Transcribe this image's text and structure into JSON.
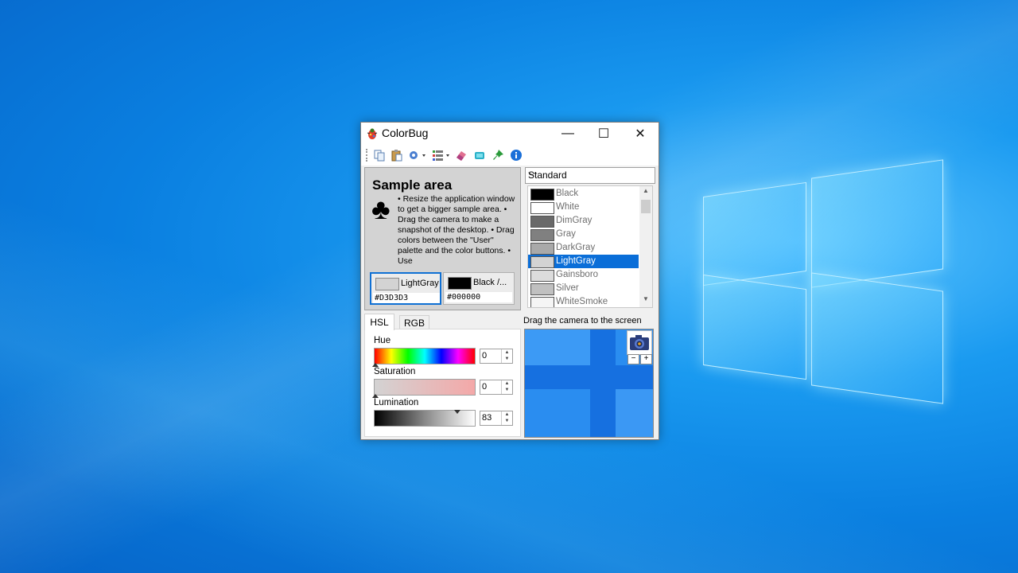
{
  "window": {
    "title": "ColorBug",
    "controls": {
      "minimize": "—",
      "maximize": "☐",
      "close": "✕"
    }
  },
  "toolbar": {
    "items": [
      "copy-icon",
      "paste-icon",
      "settings-icon",
      "palette-list-icon",
      "eraser-icon",
      "tape-icon",
      "pin-icon",
      "info-icon"
    ]
  },
  "sample": {
    "title": "Sample area",
    "text": "• Resize the application window to get a bigger sample area. • Drag the camera to make a snapshot of the desktop. • Drag colors between the \"User\" palette and the color buttons. • Use",
    "button1": {
      "label": "LightGray",
      "hex": "#D3D3D3",
      "color": "#d3d3d3"
    },
    "button2": {
      "label": "Black /...",
      "hex": "#000000",
      "color": "#000000"
    }
  },
  "palette": {
    "selected": "Standard",
    "items": [
      {
        "name": "Black",
        "color": "#000000"
      },
      {
        "name": "White",
        "color": "#ffffff"
      },
      {
        "name": "DimGray",
        "color": "#696969"
      },
      {
        "name": "Gray",
        "color": "#808080"
      },
      {
        "name": "DarkGray",
        "color": "#a9a9a9"
      },
      {
        "name": "LightGray",
        "color": "#d3d3d3"
      },
      {
        "name": "Gainsboro",
        "color": "#dcdcdc"
      },
      {
        "name": "Silver",
        "color": "#c0c0c0"
      },
      {
        "name": "WhiteSmoke",
        "color": "#f5f5f5"
      }
    ],
    "selected_item": "LightGray"
  },
  "tabs": {
    "hsl": "HSL",
    "rgb": "RGB"
  },
  "hsl": {
    "hue_label": "Hue",
    "hue_value": "0",
    "saturation_label": "Saturation",
    "saturation_value": "0",
    "lumination_label": "Lumination",
    "lumination_value": "83"
  },
  "camera": {
    "caption": "Drag the camera to the screen",
    "zoom_out": "−",
    "zoom_in": "+"
  }
}
